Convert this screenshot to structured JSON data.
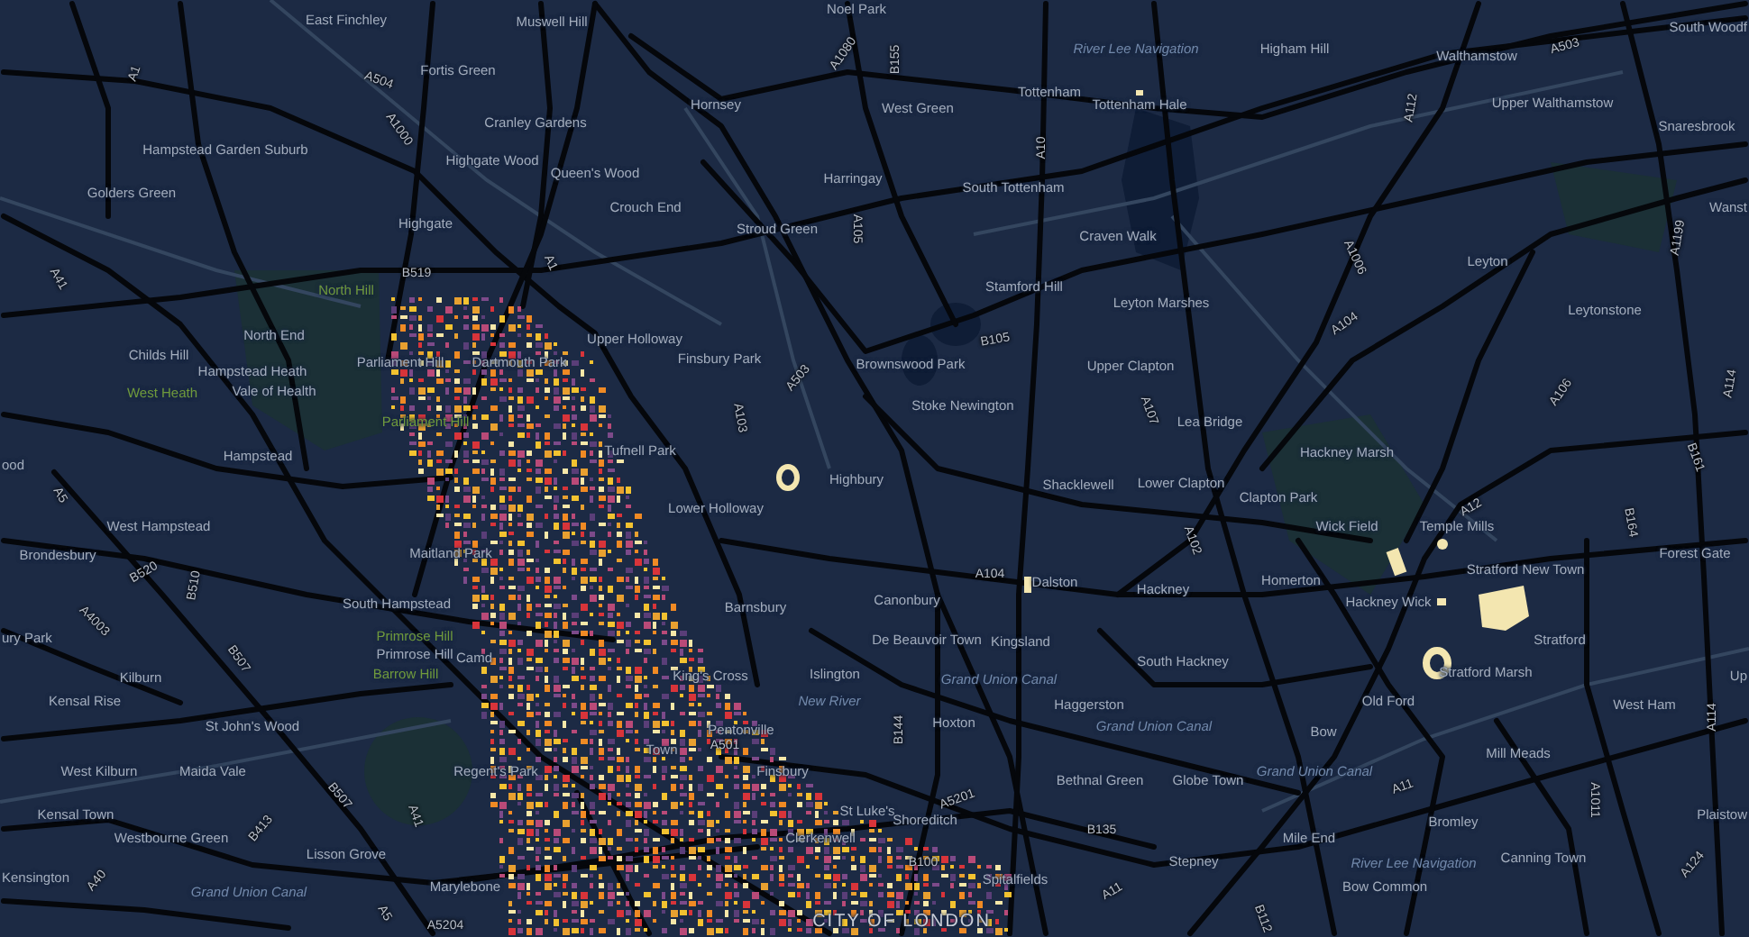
{
  "map": {
    "labels": [
      {
        "text": "East Finchley",
        "kind": "place"
      },
      {
        "text": "Muswell Hill",
        "kind": "place"
      },
      {
        "text": "Noel Park",
        "kind": "place"
      },
      {
        "text": "South Woodf",
        "kind": "place"
      },
      {
        "text": "River Lee Navigation",
        "kind": "water"
      },
      {
        "text": "Higham Hill",
        "kind": "place"
      },
      {
        "text": "Walthamstow",
        "kind": "place"
      },
      {
        "text": "Fortis Green",
        "kind": "place"
      },
      {
        "text": "Hornsey",
        "kind": "place"
      },
      {
        "text": "West Green",
        "kind": "place"
      },
      {
        "text": "Tottenham",
        "kind": "place"
      },
      {
        "text": "Tottenham Hale",
        "kind": "place"
      },
      {
        "text": "Upper Walthamstow",
        "kind": "place"
      },
      {
        "text": "Cranley Gardens",
        "kind": "place"
      },
      {
        "text": "Snaresbrook",
        "kind": "place"
      },
      {
        "text": "Hampstead Garden Suburb",
        "kind": "place"
      },
      {
        "text": "Highgate Wood",
        "kind": "place"
      },
      {
        "text": "Queen's Wood",
        "kind": "place"
      },
      {
        "text": "Harringay",
        "kind": "place"
      },
      {
        "text": "Golders Green",
        "kind": "place"
      },
      {
        "text": "South Tottenham",
        "kind": "place"
      },
      {
        "text": "Crouch End",
        "kind": "place"
      },
      {
        "text": "Wanst",
        "kind": "place"
      },
      {
        "text": "Highgate",
        "kind": "place"
      },
      {
        "text": "Stroud Green",
        "kind": "place"
      },
      {
        "text": "Craven Walk",
        "kind": "place"
      },
      {
        "text": "Leyton",
        "kind": "place"
      },
      {
        "text": "North Hill",
        "kind": "park"
      },
      {
        "text": "Stamford Hill",
        "kind": "place"
      },
      {
        "text": "Leyton Marshes",
        "kind": "place"
      },
      {
        "text": "Leytonstone",
        "kind": "place"
      },
      {
        "text": "North End",
        "kind": "place"
      },
      {
        "text": "Upper Holloway",
        "kind": "place"
      },
      {
        "text": "Childs Hill",
        "kind": "place"
      },
      {
        "text": "Hampstead Heath",
        "kind": "place"
      },
      {
        "text": "Parliament Hill",
        "kind": "place"
      },
      {
        "text": "Dartmouth Park",
        "kind": "place"
      },
      {
        "text": "Finsbury Park",
        "kind": "place"
      },
      {
        "text": "Brownswood Park",
        "kind": "place"
      },
      {
        "text": "Upper Clapton",
        "kind": "place"
      },
      {
        "text": "West Heath",
        "kind": "park"
      },
      {
        "text": "Vale of Health",
        "kind": "place"
      },
      {
        "text": "Stoke Newington",
        "kind": "place"
      },
      {
        "text": "Parliament Hill",
        "kind": "park"
      },
      {
        "text": "Lea Bridge",
        "kind": "place"
      },
      {
        "text": "ood",
        "kind": "place"
      },
      {
        "text": "Hampstead",
        "kind": "place"
      },
      {
        "text": "Tufnell Park",
        "kind": "place"
      },
      {
        "text": "Hackney Marsh",
        "kind": "place"
      },
      {
        "text": "Highbury",
        "kind": "place"
      },
      {
        "text": "Shacklewell",
        "kind": "place"
      },
      {
        "text": "Lower Clapton",
        "kind": "place"
      },
      {
        "text": "Lower Holloway",
        "kind": "place"
      },
      {
        "text": "Clapton Park",
        "kind": "place"
      },
      {
        "text": "West Hampstead",
        "kind": "place"
      },
      {
        "text": "Wick Field",
        "kind": "place"
      },
      {
        "text": "Temple Mills",
        "kind": "place"
      },
      {
        "text": "Brondesbury",
        "kind": "place"
      },
      {
        "text": "Maitland Park",
        "kind": "place"
      },
      {
        "text": "Forest Gate",
        "kind": "place"
      },
      {
        "text": "South Hampstead",
        "kind": "place"
      },
      {
        "text": "Barnsbury",
        "kind": "place"
      },
      {
        "text": "Canonbury",
        "kind": "place"
      },
      {
        "text": "Dalston",
        "kind": "place"
      },
      {
        "text": "Hackney",
        "kind": "place"
      },
      {
        "text": "Homerton",
        "kind": "place"
      },
      {
        "text": "Hackney Wick",
        "kind": "place"
      },
      {
        "text": "Stratford New Town",
        "kind": "place"
      },
      {
        "text": "ury Park",
        "kind": "place"
      },
      {
        "text": "Primrose Hill",
        "kind": "park"
      },
      {
        "text": "De Beauvoir Town",
        "kind": "place"
      },
      {
        "text": "Kingsland",
        "kind": "place"
      },
      {
        "text": "Stratford",
        "kind": "place"
      },
      {
        "text": "Primrose Hill",
        "kind": "place"
      },
      {
        "text": "Camd",
        "kind": "place"
      },
      {
        "text": "South Hackney",
        "kind": "place"
      },
      {
        "text": "Kilburn",
        "kind": "place"
      },
      {
        "text": "Barrow Hill",
        "kind": "park"
      },
      {
        "text": "King's Cross",
        "kind": "place"
      },
      {
        "text": "Islington",
        "kind": "place"
      },
      {
        "text": "Grand Union Canal",
        "kind": "water"
      },
      {
        "text": "Stratford Marsh",
        "kind": "place"
      },
      {
        "text": "Up",
        "kind": "place"
      },
      {
        "text": "Kensal Rise",
        "kind": "place"
      },
      {
        "text": "New River",
        "kind": "water"
      },
      {
        "text": "Haggerston",
        "kind": "place"
      },
      {
        "text": "Old Ford",
        "kind": "place"
      },
      {
        "text": "West Ham",
        "kind": "place"
      },
      {
        "text": "St John's Wood",
        "kind": "place"
      },
      {
        "text": "Pentonville",
        "kind": "place"
      },
      {
        "text": "Hoxton",
        "kind": "place"
      },
      {
        "text": "Grand Union Canal",
        "kind": "water"
      },
      {
        "text": "Bow",
        "kind": "place"
      },
      {
        "text": "Town",
        "kind": "place"
      },
      {
        "text": "Mill Meads",
        "kind": "place"
      },
      {
        "text": "West Kilburn",
        "kind": "place"
      },
      {
        "text": "Maida Vale",
        "kind": "place"
      },
      {
        "text": "Regent's Park",
        "kind": "place"
      },
      {
        "text": "Finsbury",
        "kind": "place"
      },
      {
        "text": "Bethnal Green",
        "kind": "place"
      },
      {
        "text": "Globe Town",
        "kind": "place"
      },
      {
        "text": "Grand Union Canal",
        "kind": "water"
      },
      {
        "text": "Kensal Town",
        "kind": "place"
      },
      {
        "text": "St Luke's",
        "kind": "place"
      },
      {
        "text": "Shoreditch",
        "kind": "place"
      },
      {
        "text": "Bromley",
        "kind": "place"
      },
      {
        "text": "Plaistow",
        "kind": "place"
      },
      {
        "text": "Westbourne Green",
        "kind": "place"
      },
      {
        "text": "Clerkenwell",
        "kind": "place"
      },
      {
        "text": "Mile End",
        "kind": "place"
      },
      {
        "text": "Lisson Grove",
        "kind": "place"
      },
      {
        "text": "Stepney",
        "kind": "place"
      },
      {
        "text": "River Lee Navigation",
        "kind": "water"
      },
      {
        "text": "Canning Town",
        "kind": "place"
      },
      {
        "text": "Kensington",
        "kind": "place"
      },
      {
        "text": "Grand Union Canal",
        "kind": "water"
      },
      {
        "text": "Marylebone",
        "kind": "place"
      },
      {
        "text": "Spitalfields",
        "kind": "place"
      },
      {
        "text": "Bow Common",
        "kind": "place"
      },
      {
        "text": "CITY OF LONDON",
        "kind": "district"
      }
    ],
    "road_numbers": [
      "A1",
      "A504",
      "A1000",
      "A1080",
      "B155",
      "A10",
      "A112",
      "A503",
      "A41",
      "B519",
      "A1",
      "A105",
      "A1006",
      "A1199",
      "B105",
      "A104",
      "A103",
      "A503",
      "A107",
      "A106",
      "A114",
      "B161",
      "A5",
      "A102",
      "A12",
      "B164",
      "B520",
      "B510",
      "A104",
      "A4003",
      "B507",
      "A501",
      "B144",
      "A114",
      "B413",
      "B507",
      "A41",
      "A5201",
      "B135",
      "A11",
      "A1011",
      "A40",
      "A5",
      "A5204",
      "B100",
      "A11",
      "B112",
      "A124"
    ]
  }
}
